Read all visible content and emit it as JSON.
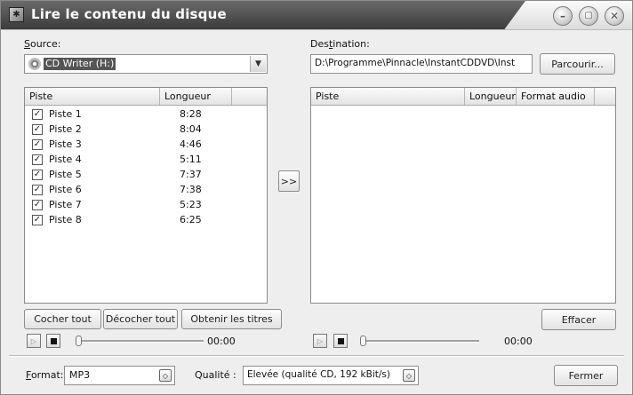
{
  "window": {
    "title": "Lire le contenu du disque"
  },
  "source": {
    "label_u": "S",
    "label_rest": "ource:",
    "drive": "CD Writer (H:)"
  },
  "destination": {
    "label_pre": "Des",
    "label_u": "t",
    "label_rest": "ination:",
    "path": "D:\\Programme\\Pinnacle\\InstantCDDVD\\Inst",
    "browse_label": "Parcourir..."
  },
  "left_list": {
    "col_track": "Piste",
    "col_length": "Longueur",
    "tracks": [
      {
        "name": "Piste 1",
        "length": "8:28",
        "checked": true
      },
      {
        "name": "Piste 2",
        "length": "8:04",
        "checked": true
      },
      {
        "name": "Piste 3",
        "length": "4:46",
        "checked": true
      },
      {
        "name": "Piste 4",
        "length": "5:11",
        "checked": true
      },
      {
        "name": "Piste 5",
        "length": "7:37",
        "checked": true
      },
      {
        "name": "Piste 6",
        "length": "7:38",
        "checked": true
      },
      {
        "name": "Piste 7",
        "length": "5:23",
        "checked": true
      },
      {
        "name": "Piste 8",
        "length": "6:25",
        "checked": true
      }
    ]
  },
  "right_list": {
    "col_track": "Piste",
    "col_length": "Longueur",
    "col_format": "Format audio"
  },
  "transfer_label": ">>",
  "buttons": {
    "check_all": "Cocher tout",
    "uncheck_all": "Décocher tout",
    "get_titles": "Obtenir les titres",
    "clear": "Effacer",
    "close": "Fermer"
  },
  "left_player": {
    "time": "00:00"
  },
  "right_player": {
    "time": "00:00"
  },
  "format": {
    "label_u": "F",
    "label_rest": "ormat:",
    "value": "MP3"
  },
  "quality": {
    "label": "Qualité :",
    "value": "Elevée (qualité CD, 192 kBit/s)"
  }
}
